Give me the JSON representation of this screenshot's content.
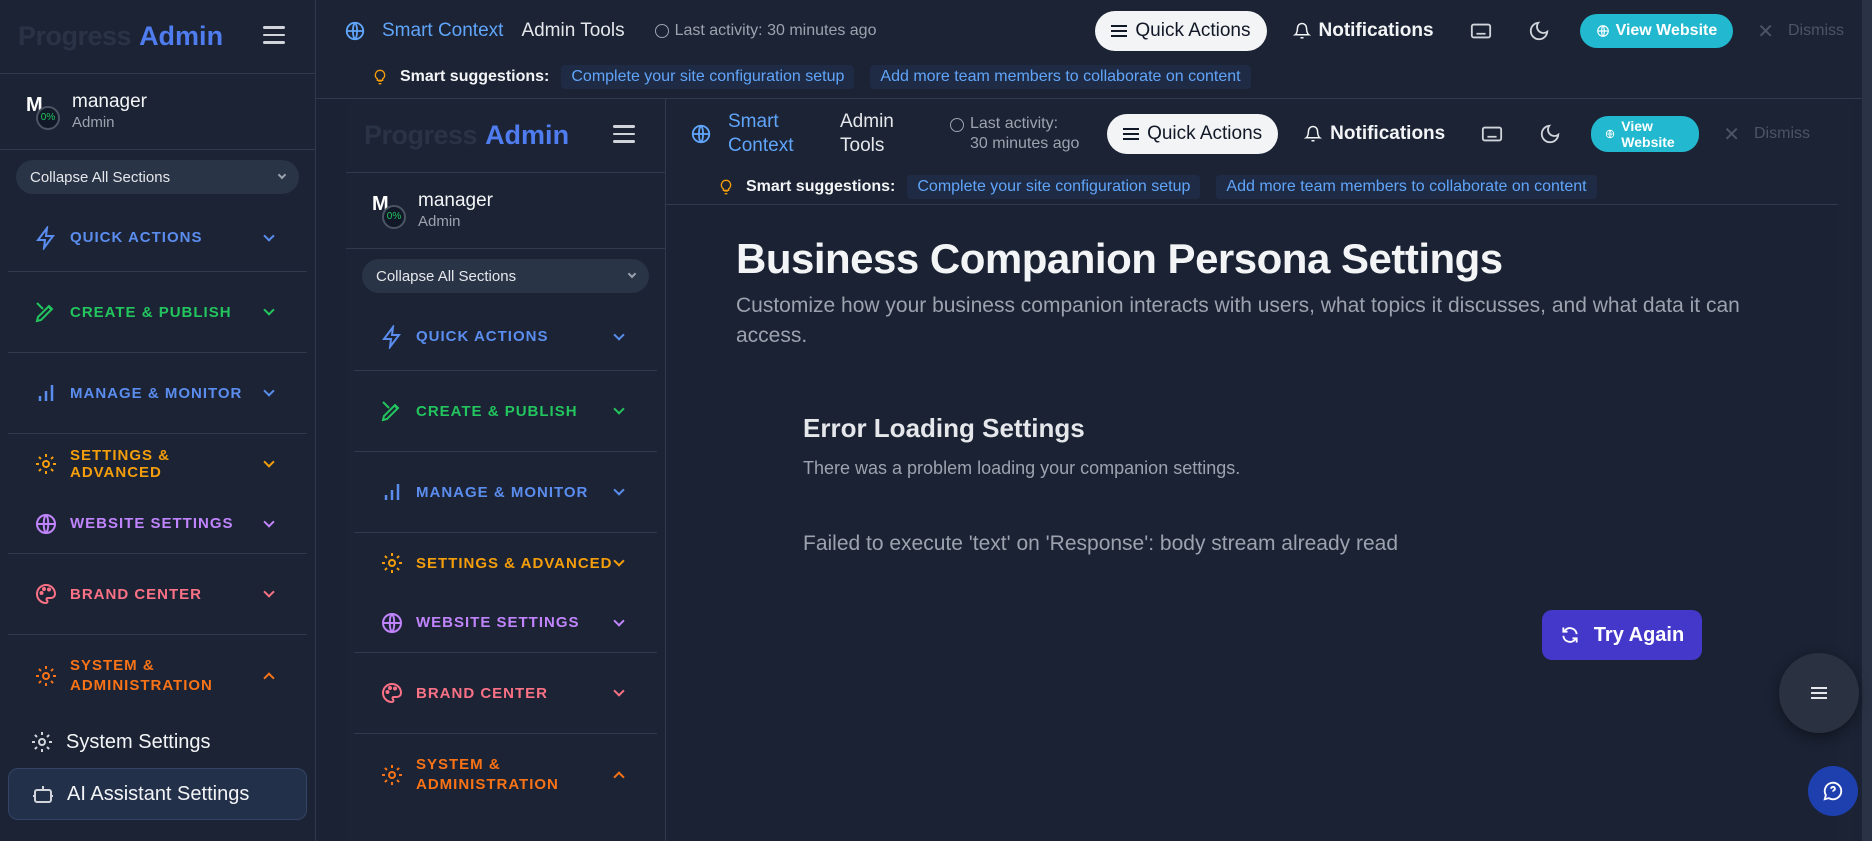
{
  "sidebar": {
    "logo_prefix": "Progress",
    "logo_admin": "Admin",
    "user": {
      "initial": "M",
      "progress": "0%",
      "name": "manager",
      "role": "Admin"
    },
    "collapse_label": "Collapse All Sections",
    "sections": [
      {
        "label": "QUICK ACTIONS",
        "color": "#5b8def",
        "icon": "lightning-icon"
      },
      {
        "label": "CREATE & PUBLISH",
        "color": "#22c55e",
        "icon": "pen-icon"
      },
      {
        "label": "MANAGE & MONITOR",
        "color": "#5b8def",
        "icon": "bar-chart-icon"
      },
      {
        "label": "SETTINGS & ADVANCED",
        "color": "#f59e0b",
        "icon": "gear-icon"
      },
      {
        "label": "WEBSITE SETTINGS",
        "color": "#c084fc",
        "icon": "globe-icon"
      },
      {
        "label": "BRAND CENTER",
        "color": "#fb7185",
        "icon": "palette-icon"
      },
      {
        "label": "SYSTEM & ADMINISTRATION",
        "color": "#f97316",
        "icon": "gear-icon"
      }
    ],
    "sub_items": [
      {
        "label": "System Settings",
        "icon": "gear-icon"
      },
      {
        "label": "AI Assistant Settings",
        "icon": "robot-icon"
      }
    ]
  },
  "topbar": {
    "smart_context": "Smart Context",
    "admin_tools": "Admin Tools",
    "last_activity": "Last activity: 30 minutes ago",
    "quick_actions": "Quick Actions",
    "notifications": "Notifications",
    "view_website": "View Website",
    "dismiss": "Dismiss",
    "suggestions_label": "Smart suggestions:",
    "suggestions": [
      "Complete your site configuration setup",
      "Add more team members to collaborate on content"
    ]
  },
  "main": {
    "title": "Business Companion Persona Settings",
    "description": "Customize how your business companion interacts with users, what topics it discusses, and what data it can access.",
    "error_title": "Error Loading Settings",
    "error_subtitle": "There was a problem loading your companion settings.",
    "error_message": "Failed to execute 'text' on 'Response': body stream already read",
    "try_again": "Try Again"
  }
}
